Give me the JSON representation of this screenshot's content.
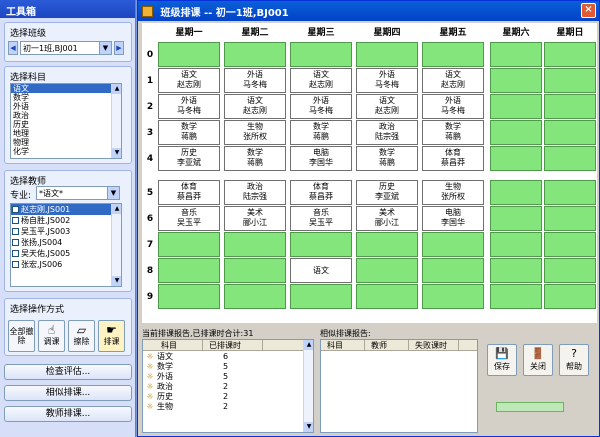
{
  "toolbox": {
    "title": "工具箱",
    "class_label": "选择班级",
    "class_value": "初一1班,BJ001",
    "subject_label": "选择科目",
    "subjects": [
      "语文",
      "数学",
      "外语",
      "政治",
      "历史",
      "地理",
      "物理",
      "化学"
    ],
    "teacher_label": "选择教师",
    "specialty_label": "专业:",
    "specialty_value": "*语文*",
    "teachers": [
      "赵志刚,JS001",
      "杨自胜,JS002",
      "吴玉平,JS003",
      "张扬,JS004",
      "吴天佑,JS005",
      "张宏,JS006"
    ],
    "op_label": "选择操作方式",
    "ops": [
      {
        "label": "全部撤除",
        "icon": "clear-all-icon"
      },
      {
        "label": "调课",
        "icon": "hand-icon"
      },
      {
        "label": "擦除",
        "icon": "eraser-icon"
      },
      {
        "label": "排课",
        "icon": "schedule-icon"
      }
    ],
    "buttons": [
      "检查评估...",
      "相似排课...",
      "教师排课..."
    ]
  },
  "window": {
    "title": "班级排课  -- 初一1班,BJ001",
    "close": "×"
  },
  "grid": {
    "days": [
      "星期一",
      "星期二",
      "星期三",
      "星期四",
      "星期五",
      "星期六",
      "星期日"
    ],
    "periods": [
      "0",
      "1",
      "2",
      "3",
      "4",
      "5",
      "6",
      "7",
      "8",
      "9"
    ],
    "cells": {
      "1": [
        "语文\n赵志刚",
        "外语\n马冬梅",
        "语文\n赵志刚",
        "外语\n马冬梅",
        "语文\n赵志刚"
      ],
      "2": [
        "外语\n马冬梅",
        "语文\n赵志刚",
        "外语\n马冬梅",
        "语文\n赵志刚",
        "外语\n马冬梅"
      ],
      "3": [
        "数学\n蒋鹏",
        "生物\n张所权",
        "数学\n蒋鹏",
        "政治\n陆宗强",
        "数学\n蒋鹏"
      ],
      "4": [
        "历史\n李亚斌",
        "数学\n蒋鹏",
        "电脑\n李国华",
        "数学\n蒋鹏",
        "体育\n蔡昌莽"
      ],
      "5": [
        "体育\n蔡昌莽",
        "政治\n陆宗强",
        "体育\n蔡昌莽",
        "历史\n李亚斌",
        "生物\n张所权"
      ],
      "6": [
        "音乐\n吴玉平",
        "美术\n郦小江",
        "音乐\n吴玉平",
        "美术\n郦小江",
        "电脑\n李国华"
      ],
      "8": [
        "",
        "",
        "语文",
        "",
        ""
      ]
    }
  },
  "report": {
    "left_title": "当前排课报告,已排课时合计:31",
    "left_headers": [
      "科目",
      "已排课时"
    ],
    "left_rows": [
      {
        "subject": "语文",
        "hours": "6"
      },
      {
        "subject": "数学",
        "hours": "5"
      },
      {
        "subject": "外语",
        "hours": "5"
      },
      {
        "subject": "政治",
        "hours": "2"
      },
      {
        "subject": "历史",
        "hours": "2"
      },
      {
        "subject": "生物",
        "hours": "2"
      }
    ],
    "right_title": "相似排课报告:",
    "right_headers": [
      "科目",
      "教师",
      "失败课时"
    ],
    "buttons": [
      {
        "label": "保存",
        "icon": "save-icon"
      },
      {
        "label": "关闭",
        "icon": "close-door-icon"
      },
      {
        "label": "帮助",
        "icon": "help-icon"
      }
    ]
  },
  "colors": {
    "empty_cell": "#84e57c",
    "title_bar": "#0a5fd8",
    "panel": "#d6dff7"
  }
}
